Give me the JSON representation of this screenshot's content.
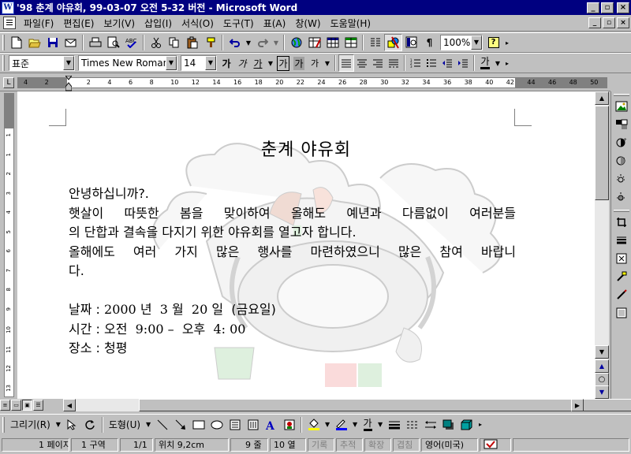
{
  "window": {
    "title": "'98 춘계 야유회, 99-03-07 오전 5-32 버전 - Microsoft Word",
    "app_icon_letter": "W",
    "minimize": "_",
    "restore": "▫",
    "close": "×"
  },
  "menu": {
    "items": [
      {
        "label": "파일(F)"
      },
      {
        "label": "편집(E)"
      },
      {
        "label": "보기(V)"
      },
      {
        "label": "삽입(I)"
      },
      {
        "label": "서식(O)"
      },
      {
        "label": "도구(T)"
      },
      {
        "label": "표(A)"
      },
      {
        "label": "창(W)"
      },
      {
        "label": "도움말(H)"
      }
    ],
    "doc_minimize": "_",
    "doc_restore": "▫",
    "doc_close": "×"
  },
  "standard_toolbar": {
    "zoom": "100%",
    "help_glyph": "?"
  },
  "format_toolbar": {
    "style": "표준",
    "font": "Times New Roman",
    "size": "14",
    "bold": "가",
    "italic": "가",
    "underline": "가",
    "char_border": "가",
    "char_shade": "가",
    "phonetic": "가",
    "font_color": "가"
  },
  "ruler": {
    "ticks": [
      "4",
      "2",
      "",
      "2",
      "4",
      "6",
      "8",
      "10",
      "12",
      "14",
      "16",
      "18",
      "20",
      "22",
      "24",
      "26",
      "28",
      "30",
      "32",
      "34",
      "36",
      "38",
      "40",
      "42",
      "44",
      "46",
      "48",
      "50"
    ]
  },
  "vruler": {
    "ticks": [
      "1",
      "1",
      "2",
      "3",
      "4",
      "5",
      "6",
      "7",
      "8",
      "9",
      "10",
      "11",
      "12",
      "13",
      "14"
    ]
  },
  "document": {
    "title": "춘계 야유회",
    "greeting": "안녕하십니까?.",
    "line1": "햇살이 따뜻한 봄을 맞이하여 올해도 예년과 다름없이 여러분들",
    "line2": "의 단합과 결속을 다지기 위한 야유회를 열고자 합니다.",
    "line3": "올해에도 여러 가지 많은 행사를 마련하였으니 많은 참여 바랍니",
    "line4": "다.",
    "date_label": "날짜 : ",
    "date_year": "2000",
    "date_year_unit": " 년  ",
    "date_month": "3",
    "date_month_unit": " 월  ",
    "date_day": "20",
    "date_day_unit": " 일  (금요일)",
    "time_label": "시간 : 오전  ",
    "time_start": "9:00 – ",
    "time_pm": " 오후  ",
    "time_end": "4: 00",
    "place_label": "장소 : 청평"
  },
  "drawing_toolbar": {
    "draw": "그리기(R)",
    "autoshape": "도형(U)",
    "font_color": "가"
  },
  "status": {
    "page": "1 페이지",
    "section": "1 구역",
    "pages": "1/1",
    "position": "위치 9,2cm",
    "line": "9 줄",
    "column": "10 열",
    "rec": "기록",
    "trk": "추적",
    "ext": "확장",
    "ovr": "겹침",
    "language": "영어(미국)"
  },
  "colors": {
    "title_bar": "#000080",
    "chrome": "#c0c0c0",
    "page": "#ffffff"
  }
}
